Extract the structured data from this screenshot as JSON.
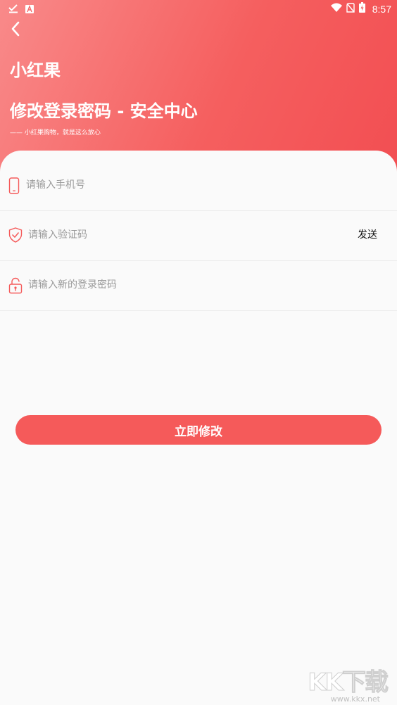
{
  "status_bar": {
    "time": "8:57",
    "left_icons": [
      "check-download-icon",
      "a-box-icon"
    ],
    "right_icons": [
      "wifi-icon",
      "no-sim-icon",
      "battery-charging-icon"
    ]
  },
  "header": {
    "back_icon": "chevron-left-icon",
    "app_name": "小红果",
    "page_title": "修改登录密码 - 安全中心",
    "slogan": "—— 小红果购物，就是这么放心"
  },
  "form": {
    "phone": {
      "icon": "phone-icon",
      "placeholder": "请输入手机号",
      "value": ""
    },
    "code": {
      "icon": "shield-check-icon",
      "placeholder": "请输入验证码",
      "value": "",
      "send_label": "发送"
    },
    "password": {
      "icon": "lock-icon",
      "placeholder": "请输入新的登录密码",
      "value": ""
    }
  },
  "submit": {
    "label": "立即修改"
  },
  "watermark": {
    "logo": "KK下载",
    "url": "www.kkx.net"
  },
  "colors": {
    "primary": "#f55a5a",
    "header_gradient_start": "#f98a8a",
    "header_gradient_end": "#f24e52",
    "background": "#fafafa",
    "divider": "#ececec",
    "placeholder": "#9a9a9a"
  }
}
